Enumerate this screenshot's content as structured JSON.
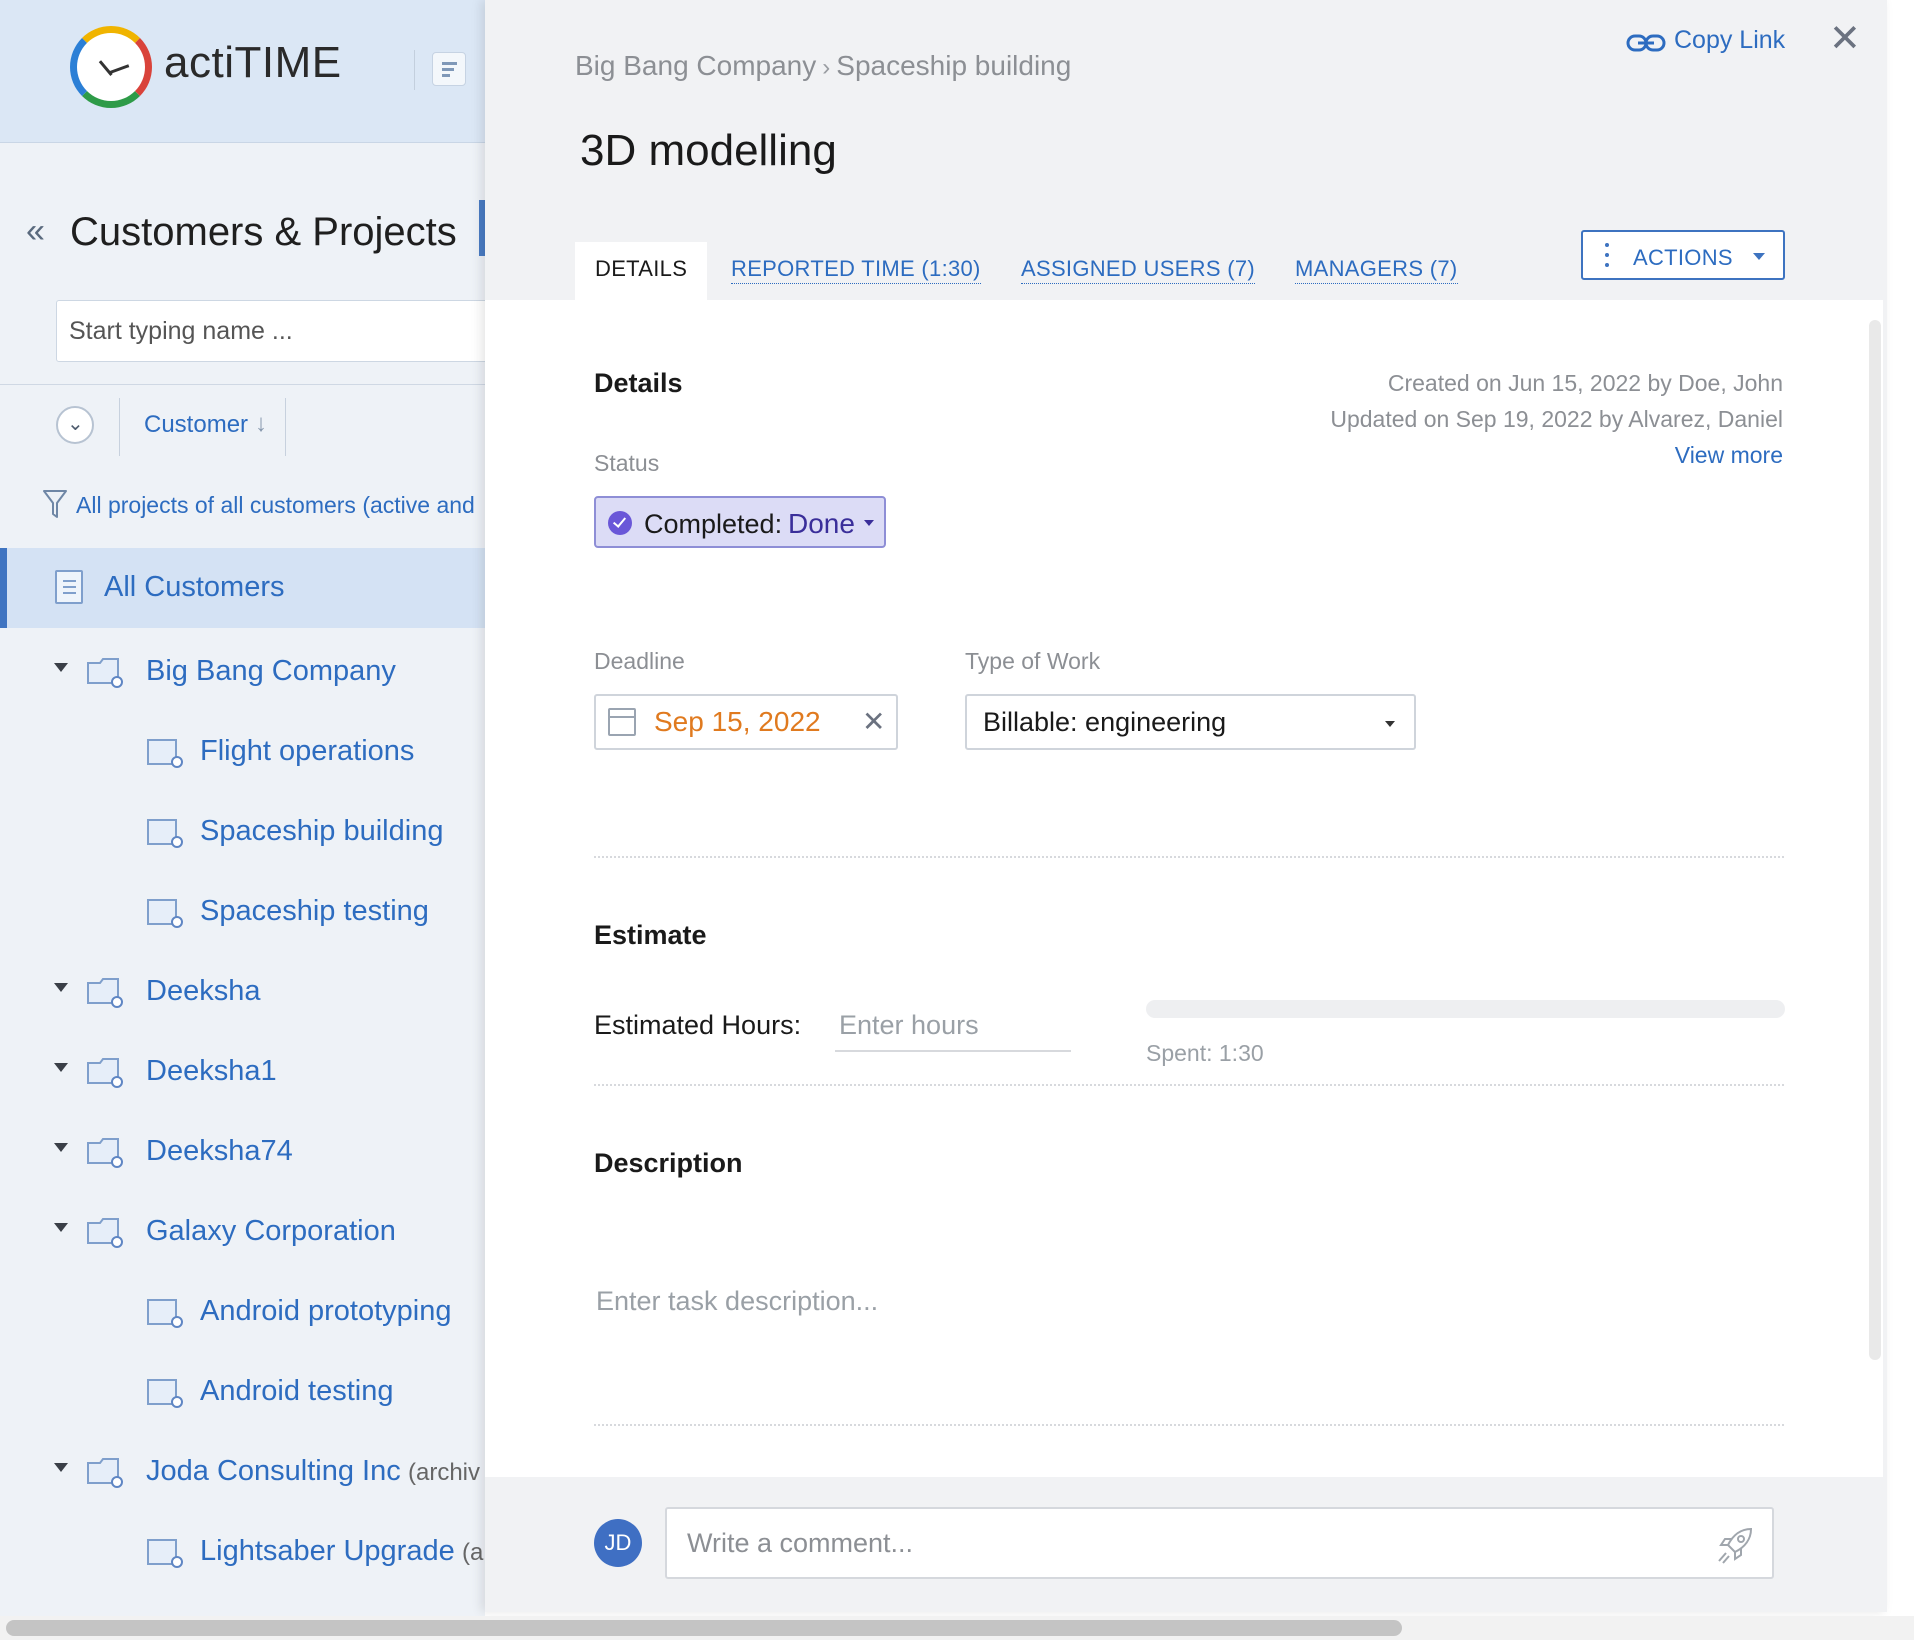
{
  "brand": {
    "name": "actiTIME"
  },
  "sidebar": {
    "title": "Customers & Projects",
    "search_placeholder": "Start typing name ...",
    "sort_label": "Customer",
    "filter_text": "All projects of all customers (active and",
    "all_customers_label": "All Customers",
    "tree": [
      {
        "label": "Big Bang Company",
        "level": 0,
        "expanded": true,
        "suffix": ""
      },
      {
        "label": "Flight operations",
        "level": 1,
        "suffix": ""
      },
      {
        "label": "Spaceship building",
        "level": 1,
        "suffix": ""
      },
      {
        "label": "Spaceship testing",
        "level": 1,
        "suffix": ""
      },
      {
        "label": "Deeksha",
        "level": 0,
        "expanded": true,
        "suffix": ""
      },
      {
        "label": "Deeksha1",
        "level": 0,
        "expanded": true,
        "suffix": ""
      },
      {
        "label": "Deeksha74",
        "level": 0,
        "expanded": true,
        "suffix": ""
      },
      {
        "label": "Galaxy Corporation",
        "level": 0,
        "expanded": true,
        "suffix": ""
      },
      {
        "label": "Android prototyping",
        "level": 1,
        "suffix": ""
      },
      {
        "label": "Android testing",
        "level": 1,
        "suffix": ""
      },
      {
        "label": "Joda Consulting Inc",
        "level": 0,
        "expanded": true,
        "suffix": "(archiv"
      },
      {
        "label": "Lightsaber Upgrade",
        "level": 1,
        "suffix": "(a"
      }
    ]
  },
  "panel": {
    "breadcrumb": {
      "customer": "Big Bang Company",
      "project": "Spaceship building"
    },
    "copy_link": "Copy Link",
    "title": "3D modelling",
    "tabs": {
      "details": "DETAILS",
      "reported_time": "REPORTED TIME (1:30)",
      "assigned_users": "ASSIGNED USERS (7)",
      "managers": "MANAGERS (7)"
    },
    "actions_label": "ACTIONS",
    "details": {
      "heading": "Details",
      "created": "Created on Jun 15, 2022 by Doe, John",
      "updated": "Updated on Sep 19, 2022 by Alvarez, Daniel",
      "view_more": "View more",
      "status_label": "Status",
      "status_key": "Completed:",
      "status_value": "Done",
      "deadline_label": "Deadline",
      "deadline_value": "Sep 15, 2022",
      "type_of_work_label": "Type of Work",
      "type_of_work_value": "Billable: engineering"
    },
    "estimate": {
      "heading": "Estimate",
      "label": "Estimated Hours:",
      "placeholder": "Enter hours",
      "spent": "Spent: 1:30",
      "progress_percent": 0
    },
    "description": {
      "heading": "Description",
      "placeholder": "Enter task description..."
    },
    "comment": {
      "avatar_initials": "JD",
      "placeholder": "Write a comment..."
    }
  },
  "colors": {
    "link_blue": "#2d6cc0",
    "deadline_orange": "#e07a1f",
    "status_purple": "#6a57d8",
    "sidebar_bg": "#eef2f7"
  }
}
